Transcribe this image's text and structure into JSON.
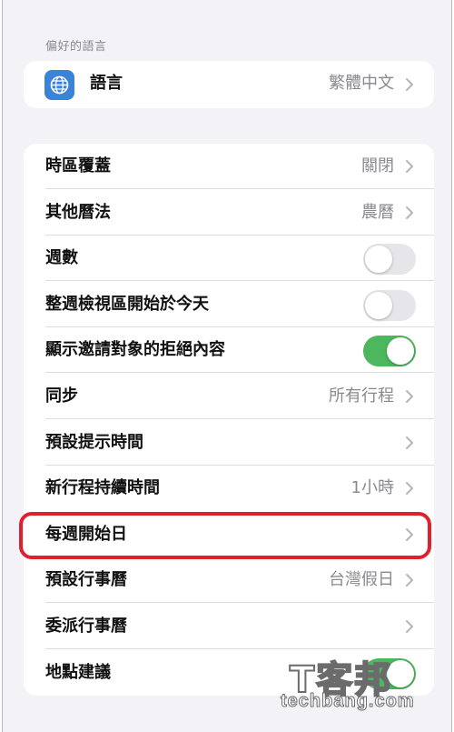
{
  "preferred_language": {
    "header": "偏好的語言",
    "row": {
      "label": "語言",
      "value": "繁體中文",
      "icon": "globe-icon"
    }
  },
  "settings": [
    {
      "key": "timezone_override",
      "label": "時區覆蓋",
      "type": "nav",
      "value": "關閉"
    },
    {
      "key": "alternate_calendars",
      "label": "其他曆法",
      "type": "nav",
      "value": "農曆"
    },
    {
      "key": "week_numbers",
      "label": "週數",
      "type": "toggle",
      "on": false
    },
    {
      "key": "week_view_starts_today",
      "label": "整週檢視區開始於今天",
      "type": "toggle",
      "on": false
    },
    {
      "key": "show_invitee_declines",
      "label": "顯示邀請對象的拒絕內容",
      "type": "toggle",
      "on": true
    },
    {
      "key": "sync",
      "label": "同步",
      "type": "nav",
      "value": "所有行程"
    },
    {
      "key": "default_alert_times",
      "label": "預設提示時間",
      "type": "nav",
      "value": ""
    },
    {
      "key": "new_event_duration",
      "label": "新行程持續時間",
      "type": "nav",
      "value": "1小時"
    },
    {
      "key": "start_week_on",
      "label": "每週開始日",
      "type": "nav",
      "value": "",
      "highlighted": true
    },
    {
      "key": "default_calendar",
      "label": "預設行事曆",
      "type": "nav",
      "value": "台灣假日"
    },
    {
      "key": "delegate_calendars",
      "label": "委派行事曆",
      "type": "nav",
      "value": ""
    },
    {
      "key": "location_suggestions",
      "label": "地點建議",
      "type": "toggle",
      "on": true
    }
  ],
  "watermark": {
    "logo": "T客邦",
    "text": "techbang.com"
  },
  "colors": {
    "toggle_on": "#4cb75c",
    "toggle_off": "#e6e6ea",
    "highlight": "#e0202e",
    "icon_bg": "#3b82d9"
  }
}
